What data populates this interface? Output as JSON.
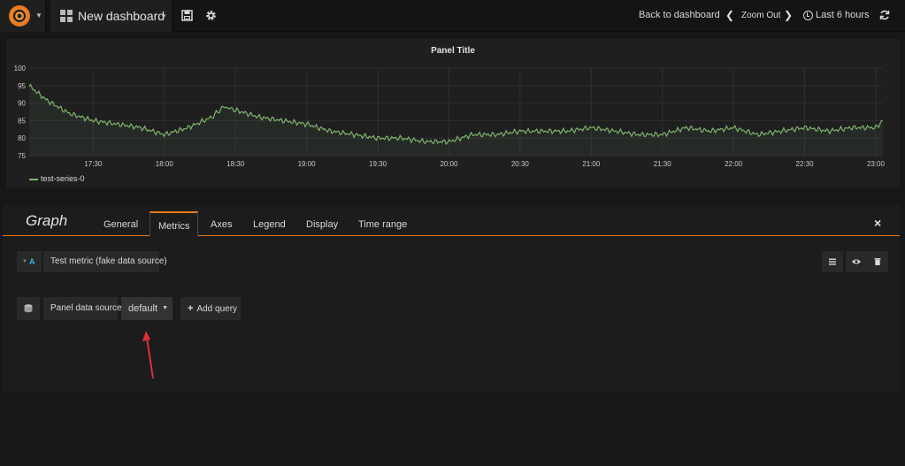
{
  "navbar": {
    "dashboard_title": "New dashboard",
    "back_to_dashboard": "Back to dashboard",
    "zoom_out": "Zoom Out",
    "time_range": "Last 6 hours"
  },
  "panel": {
    "title": "Panel Title",
    "legend_series": "test-series-0"
  },
  "chart_data": {
    "type": "line",
    "title": "Panel Title",
    "ylim": [
      75,
      100
    ],
    "y_ticks": [
      "75",
      "80",
      "85",
      "90",
      "95",
      "100"
    ],
    "x_ticks": [
      "17:30",
      "18:00",
      "18:30",
      "19:00",
      "19:30",
      "20:00",
      "20:30",
      "21:00",
      "21:30",
      "22:00",
      "22:30",
      "23:00"
    ],
    "grid": true,
    "legend": "bottom-left",
    "series": [
      {
        "name": "test-series-0",
        "color": "#7eb26d",
        "x": [
          "17:03",
          "17:10",
          "17:20",
          "17:30",
          "17:40",
          "17:50",
          "18:00",
          "18:10",
          "18:20",
          "18:25",
          "18:30",
          "18:40",
          "18:50",
          "19:00",
          "19:10",
          "19:20",
          "19:30",
          "19:40",
          "19:50",
          "20:00",
          "20:10",
          "20:20",
          "20:30",
          "20:40",
          "20:50",
          "21:00",
          "21:10",
          "21:20",
          "21:30",
          "21:40",
          "21:50",
          "22:00",
          "22:10",
          "22:20",
          "22:30",
          "22:40",
          "22:50",
          "23:00",
          "23:03"
        ],
        "values": [
          95,
          91,
          87,
          85,
          84,
          83,
          81,
          83,
          86,
          89,
          88,
          86,
          85,
          84,
          82,
          81,
          80,
          80,
          79,
          79,
          81,
          81,
          82,
          82,
          82,
          83,
          82,
          81,
          81,
          83,
          82,
          83,
          81,
          82,
          83,
          82,
          83,
          83,
          85
        ]
      }
    ]
  },
  "editor": {
    "title": "Graph",
    "close": "×",
    "tabs": [
      {
        "label": "General"
      },
      {
        "label": "Metrics"
      },
      {
        "label": "Axes"
      },
      {
        "label": "Legend"
      },
      {
        "label": "Display"
      },
      {
        "label": "Time range"
      }
    ],
    "active_tab": "Metrics",
    "query": {
      "ref_id": "A",
      "name": "Test metric (fake data source)"
    },
    "datasource": {
      "label": "Panel data source",
      "selected": "default",
      "add_query": "Add query"
    }
  },
  "colors": {
    "accent": "#eb7b18",
    "series": "#7eb26d",
    "query_ref": "#33b5e5",
    "annotation_arrow": "#e02f2f"
  }
}
